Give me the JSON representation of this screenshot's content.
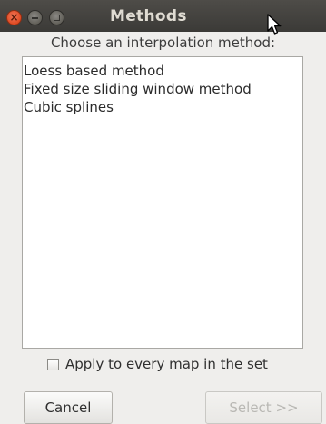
{
  "window": {
    "title": "Methods"
  },
  "dialog": {
    "prompt": "Choose an interpolation method:",
    "methods": [
      "Loess based method",
      "Fixed size sliding window method",
      "Cubic splines"
    ],
    "apply_all": {
      "label": "Apply to every map in the set",
      "checked": false
    },
    "buttons": {
      "cancel": "Cancel",
      "select": "Select >>",
      "select_enabled": false
    }
  },
  "icons": {
    "close": "close-icon",
    "minimize": "minimize-icon",
    "maximize": "maximize-icon",
    "cursor": "mouse-pointer-icon"
  },
  "colors": {
    "titlebar": "#3b3a37",
    "close_button": "#df4a22",
    "background": "#efeeec"
  }
}
